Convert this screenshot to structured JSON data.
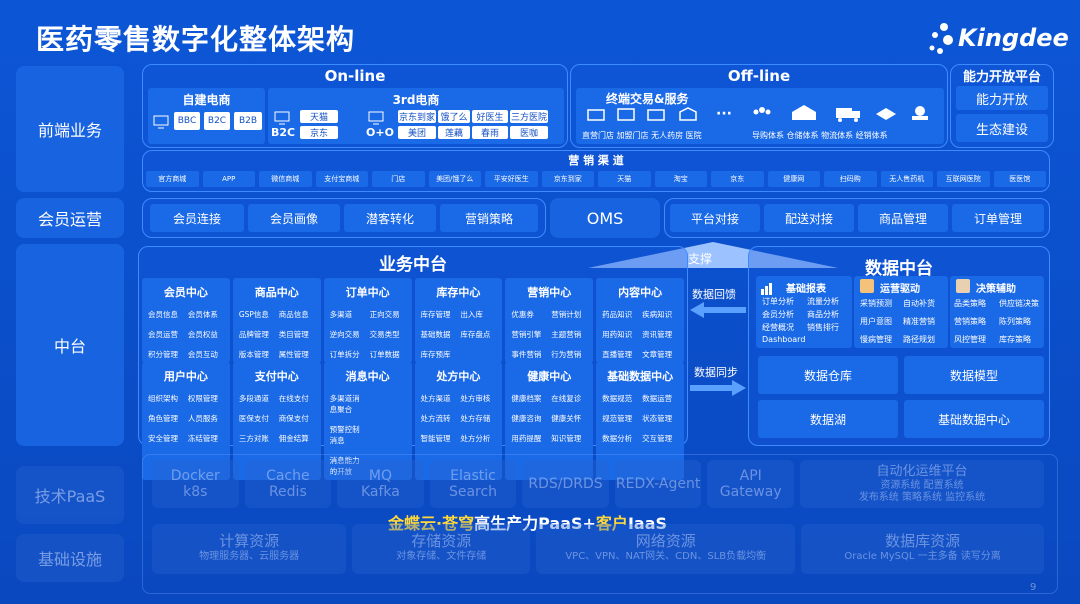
{
  "title": "医药零售数字化整体架构",
  "logo_text": "Kingdee",
  "left_labels": [
    "前端业务",
    "会员运营",
    "中台",
    "技术PaaS",
    "基础设施"
  ],
  "online": {
    "header": "On-line",
    "self_ecom": {
      "title": "自建电商",
      "items": [
        "BBC",
        "B2C",
        "B2B"
      ]
    },
    "third_ecom": {
      "title": "3rd电商",
      "b2c_label": "B2C",
      "o2o_label": "O+O",
      "b2c_items": [
        "天猫",
        "京东"
      ],
      "o2o_items": [
        "京东到家",
        "饿了么",
        "好医生",
        "三方医院",
        "美团",
        "莲藕",
        "春雨",
        "医咖"
      ]
    }
  },
  "offline": {
    "header": "Off-line",
    "section_title": "终端交易&服务",
    "terminal_items": "直营门店 加盟门店 无人药房 医院",
    "service_items": "导购体系 仓储体系 物流体系 经销体系"
  },
  "capability": {
    "header": "能力开放平台",
    "items": [
      "能力开放",
      "生态建设"
    ]
  },
  "channels": {
    "title": "营 销 渠 道",
    "items": [
      "官方商城",
      "APP",
      "微信商城",
      "支付宝商城",
      "门店",
      "美团/饿了么",
      "平安好医生",
      "京东到家",
      "天猫",
      "淘宝",
      "京东",
      "健康网",
      "扫码购",
      "无人售药机",
      "互联网医院",
      "医医馆"
    ]
  },
  "member_ops": {
    "items": [
      "会员连接",
      "会员画像",
      "潜客转化",
      "营销策略"
    ],
    "oms": "OMS",
    "oms_items": [
      "平台对接",
      "配送对接",
      "商品管理",
      "订单管理"
    ]
  },
  "business_center": {
    "title": "业务中台",
    "support": "支撑",
    "row1": [
      {
        "h": "会员中心",
        "items": [
          "会员信息",
          "会员体系",
          "会员运营",
          "会员权益",
          "积分管理",
          "会员互动"
        ]
      },
      {
        "h": "商品中心",
        "items": [
          "GSP信息",
          "商品信息",
          "品牌管理",
          "类目管理",
          "版本管理",
          "属性管理"
        ]
      },
      {
        "h": "订单中心",
        "items": [
          "多渠道",
          "正向交易",
          "逆向交易",
          "交易类型",
          "订单拆分",
          "订单数据"
        ]
      },
      {
        "h": "库存中心",
        "items": [
          "库存管理",
          "出入库",
          "基础数据",
          "库存盘点",
          "库存预库",
          ""
        ]
      },
      {
        "h": "营销中心",
        "items": [
          "优惠券",
          "营销计划",
          "营销引擎",
          "主题营销",
          "事件营销",
          "行为营销"
        ]
      },
      {
        "h": "内容中心",
        "items": [
          "药品知识",
          "疾病知识",
          "用药知识",
          "资讯管理",
          "直播管理",
          "文章管理"
        ]
      }
    ],
    "row2": [
      {
        "h": "用户中心",
        "items": [
          "组织架构",
          "权限管理",
          "角色管理",
          "人员服务",
          "安全管理",
          "冻结管理"
        ]
      },
      {
        "h": "支付中心",
        "items": [
          "多段通道",
          "在线支付",
          "医保支付",
          "商保支付",
          "三方对账",
          "佣金结算"
        ]
      },
      {
        "h": "消息中心",
        "items": [
          "多渠道消息聚合",
          "",
          "预警控制消息",
          "",
          "消息能力的开放",
          ""
        ]
      },
      {
        "h": "处方中心",
        "items": [
          "处方渠道",
          "处方审核",
          "处方流转",
          "处方存储",
          "智能管理",
          "处方分析"
        ]
      },
      {
        "h": "健康中心",
        "items": [
          "健康档案",
          "在线复诊",
          "健康咨询",
          "健康关怀",
          "用药提醒",
          "知识管理"
        ]
      },
      {
        "h": "基础数据中心",
        "items": [
          "数据规范",
          "数据运营",
          "规范管理",
          "状态管理",
          "数据分析",
          "交互管理"
        ]
      }
    ]
  },
  "data_center": {
    "title": "数据中台",
    "arrow_back": "数据回馈",
    "arrow_sync": "数据同步",
    "reports": {
      "h": "基础报表",
      "items": [
        "订单分析",
        "流量分析",
        "会员分析",
        "商品分析",
        "经营概况",
        "销售排行",
        "Dashboard",
        ""
      ]
    },
    "ops": {
      "h": "运营驱动",
      "items": [
        "采销预测",
        "自动补货",
        "用户意图",
        "精准营销",
        "慢病管理",
        "路径规划"
      ]
    },
    "decision": {
      "h": "决策辅助",
      "items": [
        "品类策略",
        "供应链决策",
        "营销策略",
        "陈列策略",
        "风控管理",
        "库存策略"
      ]
    },
    "boxes": [
      "数据仓库",
      "数据模型",
      "数据湖",
      "基础数据中心"
    ]
  },
  "paas": {
    "items": [
      {
        "a": "Docker",
        "b": "k8s"
      },
      {
        "a": "Cache",
        "b": "Redis"
      },
      {
        "a": "MQ",
        "b": "Kafka"
      },
      {
        "a": "Elastic Search",
        "b": ""
      },
      {
        "a": "RDS/DRDS",
        "b": ""
      },
      {
        "a": "REDX-Agent",
        "b": ""
      },
      {
        "a": "API Gateway",
        "b": ""
      }
    ],
    "auto": {
      "h": "自动化运维平台",
      "l1": "资源系统  配置系统",
      "l2": "发布系统  策略系统  监控系统"
    },
    "highlight_a": "金蝶云·苍穹",
    "highlight_b": "高生产力PaaS+",
    "highlight_c": "客户",
    "highlight_d": "IaaS"
  },
  "infra": [
    {
      "h": "计算资源",
      "s": "物理服务器、云服务器"
    },
    {
      "h": "存储资源",
      "s": "对象存储、文件存储"
    },
    {
      "h": "网络资源",
      "s": "VPC、VPN、NAT网关、CDN、SLB负载均衡"
    },
    {
      "h": "数据库资源",
      "s": "Oracle MySQL 一主多备 读写分离"
    }
  ],
  "page_number": "9"
}
